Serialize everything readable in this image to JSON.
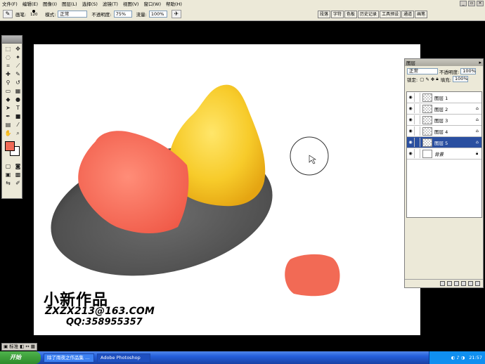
{
  "menubar": {
    "items": [
      "文件(F)",
      "编辑(E)",
      "图像(I)",
      "图层(L)",
      "选择(S)",
      "滤镜(T)",
      "视图(V)",
      "窗口(W)",
      "帮助(H)"
    ]
  },
  "options": {
    "brush_label": "画笔:",
    "brush_size": "120",
    "mode_label": "模式:",
    "mode_value": "正常",
    "opacity_label": "不透明度:",
    "opacity_value": "75%",
    "flow_label": "流量:",
    "flow_value": "100%",
    "wells": [
      "段落",
      "字符",
      "色板",
      "历史记录",
      "工具预设",
      "通道",
      "画笔"
    ]
  },
  "layers_panel": {
    "tab": "图层",
    "blend_mode": "正常",
    "opacity_label": "不透明度:",
    "opacity_value": "100%",
    "lock_label": "锁定:",
    "fill_label": "填充:",
    "fill_value": "100%",
    "layers": [
      {
        "name": "图层 1"
      },
      {
        "name": "图层 2"
      },
      {
        "name": "图层 3"
      },
      {
        "name": "图层 4"
      },
      {
        "name": "图层 5",
        "selected": true
      },
      {
        "name": "背景"
      }
    ]
  },
  "canvas": {
    "watermark_big": "小新作品",
    "watermark_email": "ZXZX213@163.COM",
    "watermark_qq": "QQ:358955357"
  },
  "statusbar": {
    "label": "标准"
  },
  "taskbar": {
    "start": "开始",
    "tasks": [
      "除了雨夜之作品集 ...",
      "Adobe Photoshop"
    ],
    "clock": "21:57"
  },
  "colors": {
    "foreground": "#f06a55",
    "background": "#ffffff",
    "selected_layer": "#2a4fa0"
  }
}
